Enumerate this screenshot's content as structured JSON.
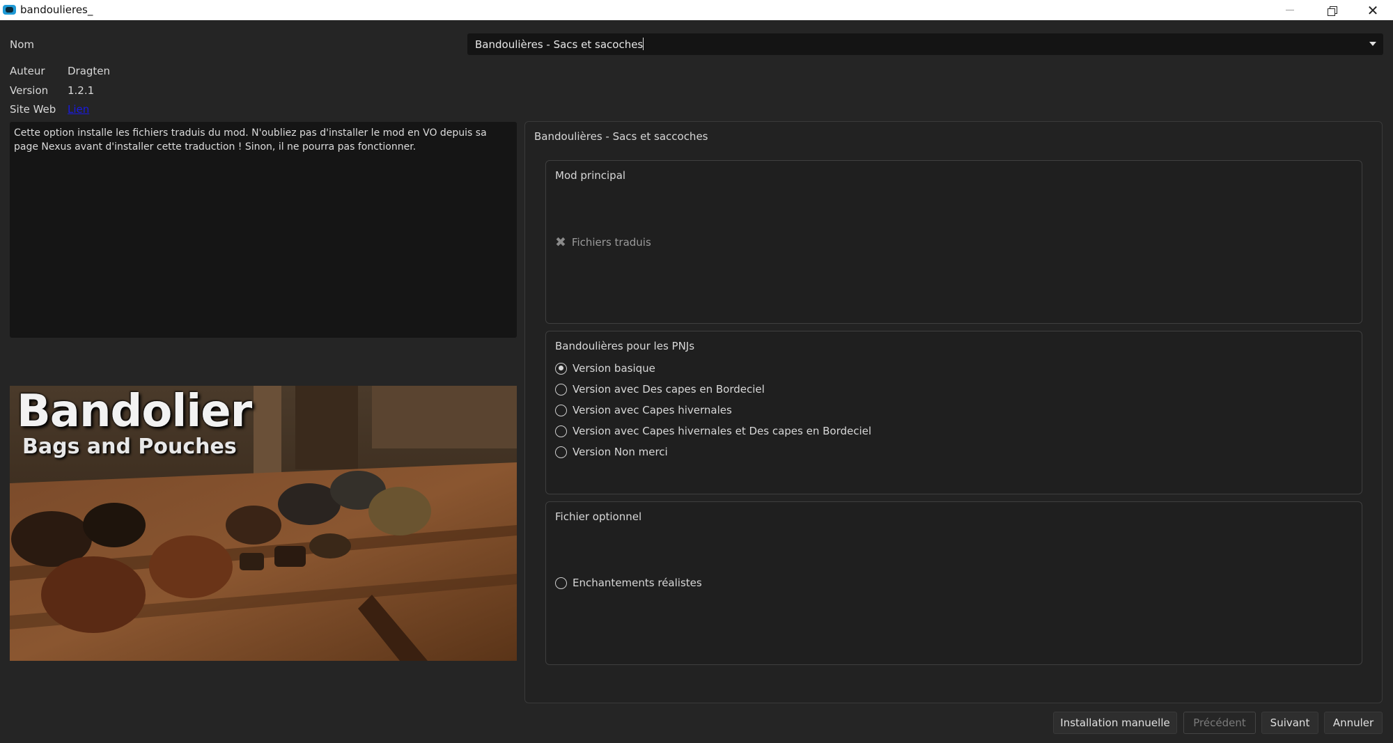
{
  "window": {
    "title": "bandoulieres_"
  },
  "info": {
    "nom_label": "Nom",
    "auteur_label": "Auteur",
    "auteur_value": "Dragten",
    "version_label": "Version",
    "version_value": "1.2.1",
    "site_label": "Site Web",
    "site_link": "Lien"
  },
  "combo": {
    "value": "Bandoulières - Sacs et sacoches"
  },
  "description": "Cette option installe les fichiers traduis du mod. N'oubliez pas d'installer le mod en VO depuis sa page Nexus avant d'installer cette traduction ! Sinon, il ne pourra pas fonctionner.",
  "preview": {
    "title": "Bandolier",
    "subtitle": "Bags and Pouches"
  },
  "panel": {
    "title": "Bandoulières - Sacs et saccoches",
    "groups": [
      {
        "title": "Mod principal",
        "options": [
          {
            "label": "Fichiers traduis",
            "type": "required"
          }
        ]
      },
      {
        "title": "Bandoulières pour les PNJs",
        "options": [
          {
            "label": "Version basique",
            "type": "radio",
            "checked": true
          },
          {
            "label": "Version avec Des capes en Bordeciel",
            "type": "radio",
            "checked": false
          },
          {
            "label": "Version avec Capes hivernales",
            "type": "radio",
            "checked": false
          },
          {
            "label": "Version avec Capes hivernales et Des capes en Bordeciel",
            "type": "radio",
            "checked": false
          },
          {
            "label": "Version Non merci",
            "type": "radio",
            "checked": false
          }
        ]
      },
      {
        "title": "Fichier optionnel",
        "options": [
          {
            "label": "Enchantements réalistes",
            "type": "radio",
            "checked": false
          }
        ]
      }
    ]
  },
  "buttons": {
    "manual": "Installation manuelle",
    "previous": "Précédent",
    "next": "Suivant",
    "cancel": "Annuler"
  },
  "colors": {
    "background": "#252525",
    "field": "#141414",
    "link": "#1a1ae0"
  },
  "icons": [
    "app-icon",
    "minimize-icon",
    "maximize-icon",
    "close-icon",
    "chevron-down-icon",
    "x-mark-icon"
  ]
}
